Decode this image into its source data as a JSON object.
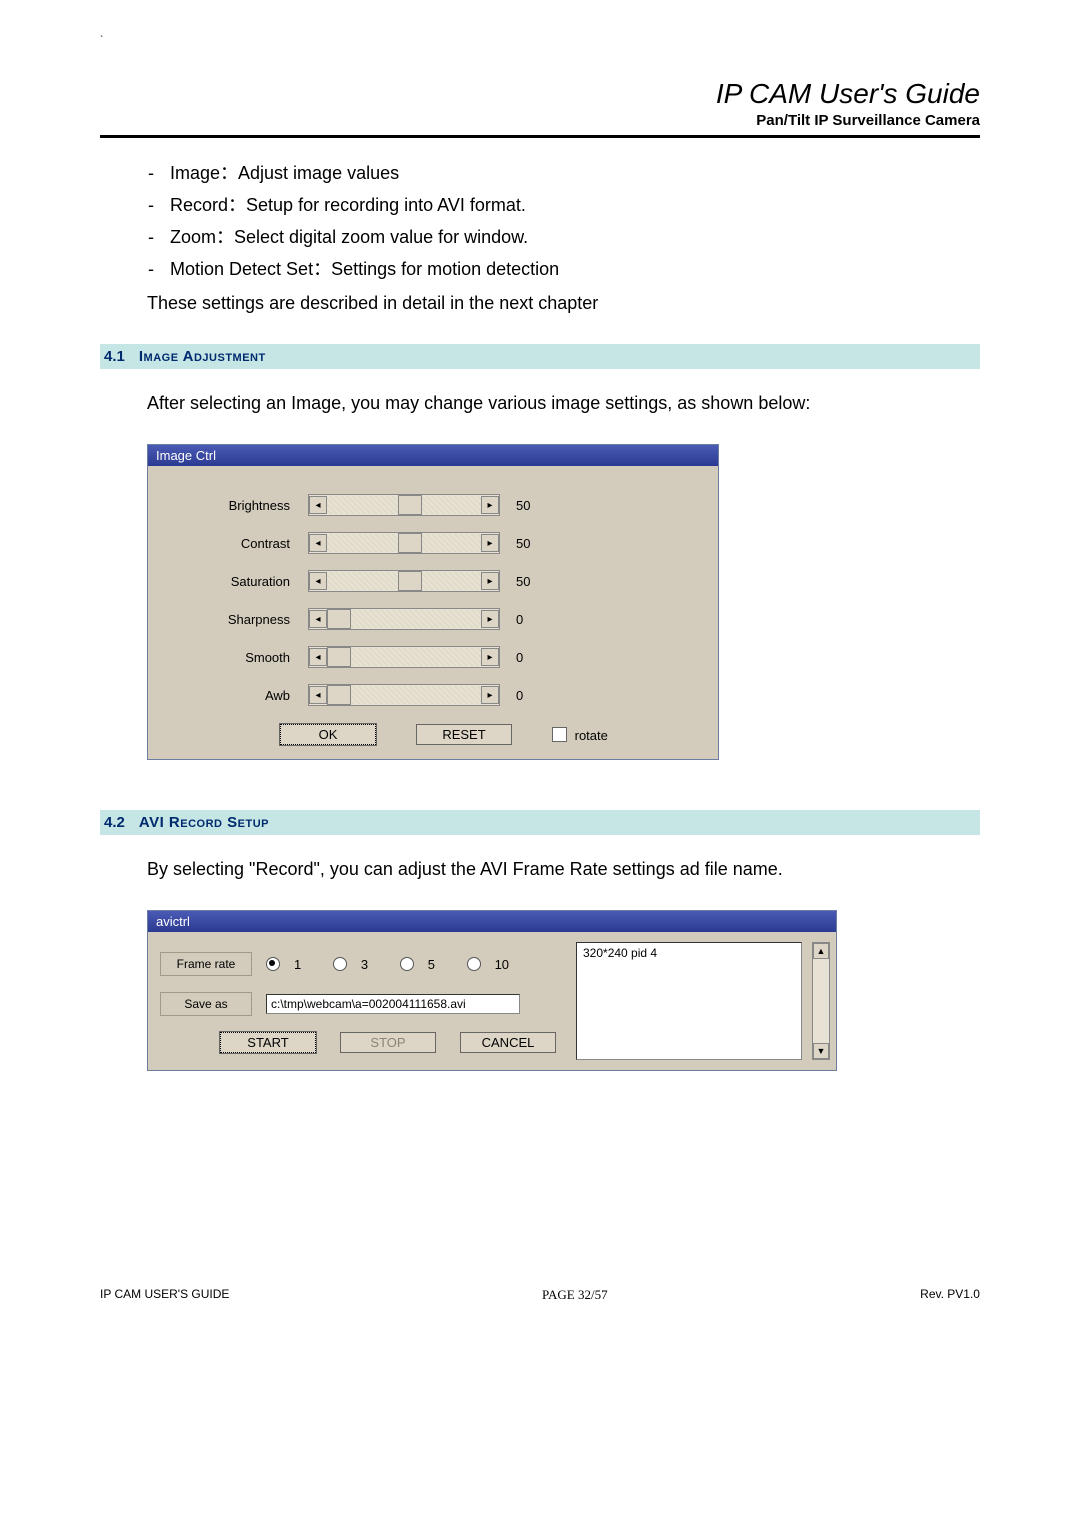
{
  "header": {
    "title": "IP CAM User's Guide",
    "subtitle": "Pan/Tilt IP Surveillance Camera"
  },
  "bullets": {
    "b1": "Image：Adjust image values",
    "b2": "Record：Setup for recording into AVI format.",
    "b3": "Zoom：Select digital zoom value for window.",
    "b4": "Motion Detect Set：Settings for motion detection"
  },
  "followup": "These settings are described in detail in the next chapter",
  "section41": {
    "num": "4.1",
    "title": "Image Adjustment"
  },
  "para41": "After selecting an Image, you may change various image settings, as shown below:",
  "imageCtrl": {
    "title": "Image Ctrl",
    "rows": [
      {
        "label": "Brightness",
        "value": "50",
        "thumb_pct": 46
      },
      {
        "label": "Contrast",
        "value": "50",
        "thumb_pct": 46
      },
      {
        "label": "Saturation",
        "value": "50",
        "thumb_pct": 46
      },
      {
        "label": "Sharpness",
        "value": "0",
        "thumb_pct": 0
      },
      {
        "label": "Smooth",
        "value": "0",
        "thumb_pct": 0
      },
      {
        "label": "Awb",
        "value": "0",
        "thumb_pct": 0
      }
    ],
    "ok": "OK",
    "reset": "RESET",
    "rotate": "rotate"
  },
  "section42": {
    "num": "4.2",
    "title": "AVI Record Setup"
  },
  "para42": "By selecting \"Record\", you can adjust the AVI Frame Rate settings ad file name.",
  "avictrl": {
    "title": "avictrl",
    "framerate_label": "Frame rate",
    "rates": {
      "r1": "1",
      "r3": "3",
      "r5": "5",
      "r10": "10"
    },
    "saveas_label": "Save as",
    "saveas_value": "c:\\tmp\\webcam\\a=002004111658.avi",
    "list_item": "320*240 pid 4",
    "start": "START",
    "stop": "STOP",
    "cancel": "CANCEL"
  },
  "footer": {
    "left": "IP CAM USER'S GUIDE",
    "mid_label": "PAGE ",
    "mid_page": "32/57",
    "right": "Rev. PV1.0"
  }
}
